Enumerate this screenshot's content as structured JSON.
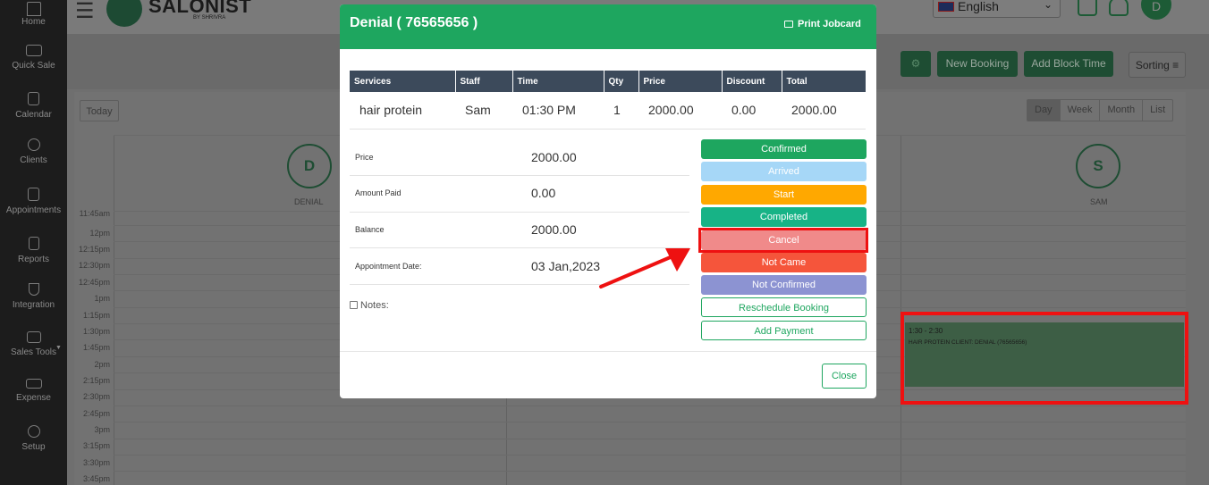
{
  "sidebar": {
    "items": [
      {
        "label": "Home",
        "icon": "home-icon"
      },
      {
        "label": "Quick Sale",
        "icon": "quick-sale-icon"
      },
      {
        "label": "Calendar",
        "icon": "calendar-icon"
      },
      {
        "label": "Clients",
        "icon": "clients-icon"
      },
      {
        "label": "Appointments",
        "icon": "appointments-icon"
      },
      {
        "label": "Reports",
        "icon": "reports-icon"
      },
      {
        "label": "Integration",
        "icon": "integration-icon"
      },
      {
        "label": "Sales Tools",
        "icon": "sales-tools-icon"
      },
      {
        "label": "Expense",
        "icon": "expense-icon"
      },
      {
        "label": "Setup",
        "icon": "setup-icon"
      }
    ]
  },
  "header": {
    "logo_text": "SALONIST",
    "logo_sub": "BY SHRIVRA",
    "language": "English",
    "avatar_initial": "D"
  },
  "actions": {
    "new_booking": "New Booking",
    "add_block_time": "Add Block Time",
    "sorting": "Sorting ≡"
  },
  "calendar": {
    "today": "Today",
    "views": [
      "Day",
      "Week",
      "Month",
      "List"
    ],
    "staff": [
      {
        "initial": "D",
        "name": "DENIAL"
      },
      {
        "initial": "S",
        "name": "SAM"
      }
    ],
    "time_slots": [
      "11:45am",
      "12pm",
      "12:15pm",
      "12:30pm",
      "12:45pm",
      "1pm",
      "1:15pm",
      "1:30pm",
      "1:45pm",
      "2pm",
      "2:15pm",
      "2:30pm",
      "2:45pm",
      "3pm",
      "3:15pm",
      "3:30pm",
      "3:45pm"
    ],
    "booking": {
      "time": "1:30 - 2:30",
      "details": "HAIR PROTEIN CLIENT: DENIAL (76565656)"
    }
  },
  "modal": {
    "title": "Denial ( 76565656 )",
    "print_label": "Print Jobcard",
    "table": {
      "headers": [
        "Services",
        "Staff",
        "Time",
        "Qty",
        "Price",
        "Discount",
        "Total"
      ],
      "rows": [
        [
          "hair protein",
          "Sam",
          "01:30 PM",
          "1",
          "2000.00",
          "0.00",
          "2000.00"
        ]
      ]
    },
    "info": {
      "price_label": "Price",
      "price": "2000.00",
      "paid_label": "Amount Paid",
      "paid": "0.00",
      "balance_label": "Balance",
      "balance": "2000.00",
      "date_label": "Appointment Date:",
      "date": "03 Jan,2023"
    },
    "notes_label": "Notes:",
    "status_buttons": {
      "confirmed": "Confirmed",
      "arrived": "Arrived",
      "start": "Start",
      "completed": "Completed",
      "cancel": "Cancel",
      "not_came": "Not Came",
      "not_confirmed": "Not Confirmed",
      "reschedule": "Reschedule Booking",
      "add_payment": "Add Payment"
    },
    "close_label": "Close"
  },
  "colors": {
    "brand_green": "#1ea65f",
    "highlight_red": "#ee1111"
  }
}
